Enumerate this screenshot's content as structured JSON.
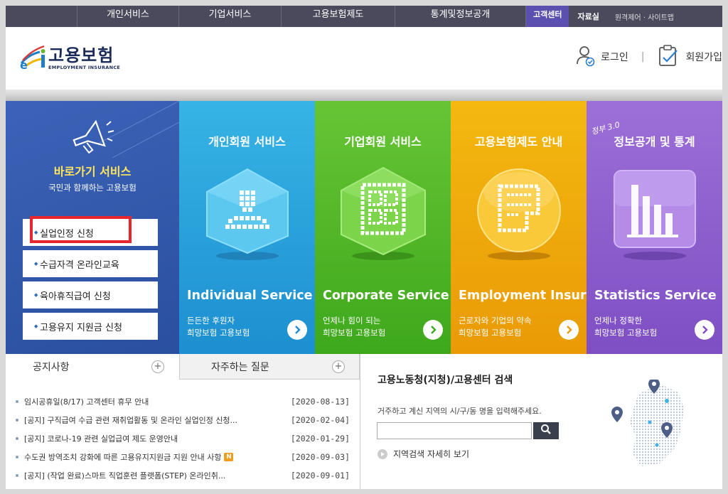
{
  "topnav": {
    "menu": [
      "개인서비스",
      "기업서비스",
      "고용보험제도",
      "통계및정보공개"
    ],
    "customer_center": "고객센터",
    "library": "자료실",
    "remote": "원격제어 · 사이트맵"
  },
  "header": {
    "logo_ko": "고용보험",
    "logo_en": "EMPLOYMENT INSURANCE",
    "login": "로그인",
    "separator": "|",
    "signup": "회원가입"
  },
  "quick": {
    "title": "바로가기 서비스",
    "subtitle": "국민과 함께하는 고용보험",
    "items": [
      "실업인정 신청",
      "수급자격 온라인교육",
      "육아휴직급여 신청",
      "고용유지 지원금 신청"
    ]
  },
  "cards": [
    {
      "title": "개인회원 서비스",
      "en": "Individual Service",
      "desc1": "든든한 후원자",
      "desc2": "희망보험 고용보험"
    },
    {
      "title": "기업회원 서비스",
      "en": "Corporate Service",
      "desc1": "언제나 힘이 되는",
      "desc2": "희망보험 고용보험"
    },
    {
      "title": "고용보험제도 안내",
      "en": "Employment Insurance",
      "desc1": "근로자와 기업의 약속",
      "desc2": "희망보험 고용보험"
    },
    {
      "title": "정보공개 및 통계",
      "tag": "정부 3.0",
      "en": "Statistics Service",
      "desc1": "언제나 정확한",
      "desc2": "희망보험 고용보험"
    }
  ],
  "tabs": {
    "notice": "공지사항",
    "faq": "자주하는 질문",
    "plus": "+"
  },
  "notices": [
    {
      "title": "임시공휴일(8/17) 고객센터 휴무 안내",
      "date": "[2020-08-13]"
    },
    {
      "title": "[공지] 구직급여 수급 관련 재취업활동 및 온라인 실업인정 신청...",
      "date": "[2020-02-04]"
    },
    {
      "title": "[공지] 코로나-19 관련 실업급여 제도 운영안내",
      "date": "[2020-01-29]"
    },
    {
      "title": "수도권 방역조치 강화에 따른 고용유지지원금 지원 안내 사항",
      "date": "[2020-09-03]",
      "badge": "N"
    },
    {
      "title": "[공지] (작업 완료)스마트 직업훈련 플랫폼(STEP) 온라인취...",
      "date": "[2020-09-01]"
    }
  ],
  "search": {
    "title": "고용노동청(지청)/고용센터 검색",
    "hint": "거주하고 계신 지역의 시/구/동 명을 입력해주세요.",
    "value": "",
    "more": "지역검색 자세히 보기"
  },
  "colors": {
    "nav": "#4a4a5c",
    "quick": "#2f57a8",
    "individual": "#29a3dd",
    "corporate": "#55b92a",
    "insurance": "#efaa0b",
    "statistics": "#8c5fcf"
  }
}
